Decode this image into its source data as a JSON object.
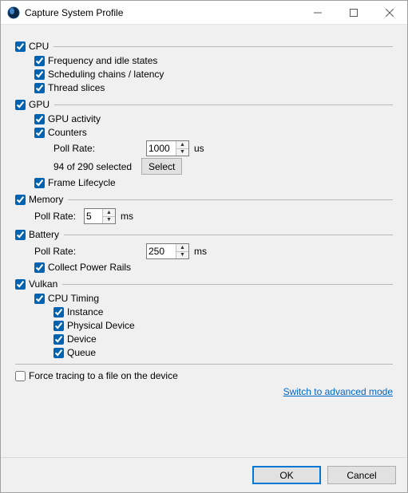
{
  "window": {
    "title": "Capture System Profile"
  },
  "cpu": {
    "label": "CPU",
    "freq": "Frequency and idle states",
    "sched": "Scheduling chains / latency",
    "slices": "Thread slices"
  },
  "gpu": {
    "label": "GPU",
    "activity": "GPU activity",
    "counters": "Counters",
    "poll_label": "Poll Rate:",
    "poll_value": "1000",
    "poll_unit": "us",
    "selected_text": "94 of 290 selected",
    "select_btn": "Select",
    "frame_lifecycle": "Frame Lifecycle"
  },
  "memory": {
    "label": "Memory",
    "poll_label": "Poll Rate:",
    "poll_value": "5",
    "poll_unit": "ms"
  },
  "battery": {
    "label": "Battery",
    "poll_label": "Poll Rate:",
    "poll_value": "250",
    "poll_unit": "ms",
    "power_rails": "Collect Power Rails"
  },
  "vulkan": {
    "label": "Vulkan",
    "cpu_timing": "CPU Timing",
    "instance": "Instance",
    "physical_device": "Physical Device",
    "device": "Device",
    "queue": "Queue"
  },
  "force_trace": "Force tracing to a file on the device",
  "switch_link": "Switch to advanced mode",
  "buttons": {
    "ok": "OK",
    "cancel": "Cancel"
  }
}
